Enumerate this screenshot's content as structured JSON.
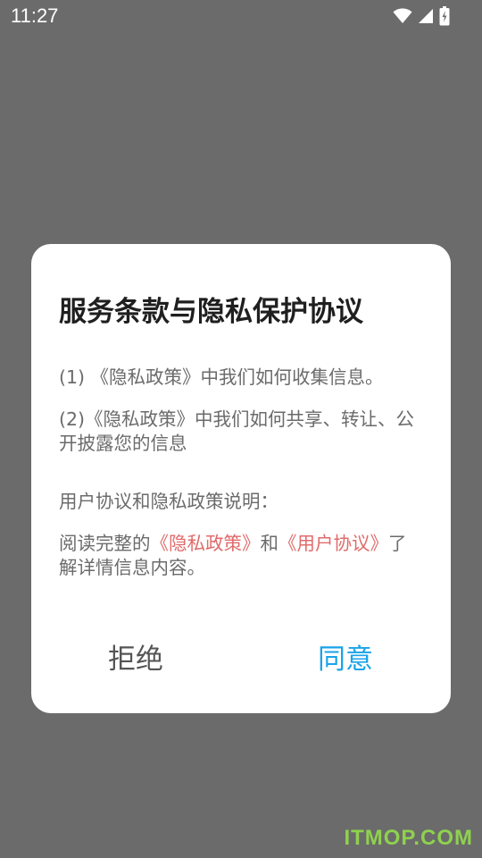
{
  "status_bar": {
    "time": "11:27",
    "icons": [
      "wifi-icon",
      "cellular-signal-icon",
      "battery-charging-icon"
    ],
    "icon_color": "#ffffff"
  },
  "dialog": {
    "title": "服务条款与隐私保护协议",
    "paragraph1": "(1) 《隐私政策》中我们如何收集信息。",
    "paragraph2": "(2)《隐私政策》中我们如何共享、转让、公开披露您的信息",
    "paragraph3": "用户协议和隐私政策说明：",
    "paragraph4": {
      "prefix": "阅读完整的",
      "privacy_link": "《隐私政策》",
      "connector": "和",
      "user_agreement_link": "《用户协议》",
      "suffix": "了解详情信息内容。"
    },
    "reject_label": "拒绝",
    "agree_label": "同意"
  },
  "colors": {
    "overlay": "#6b6b6b",
    "dialog_bg": "#ffffff",
    "link": "#e06b6b",
    "agree": "#1aa3e8",
    "reject": "#555555",
    "watermark": "#8fd14f"
  },
  "watermark": "ITMOP.COM"
}
